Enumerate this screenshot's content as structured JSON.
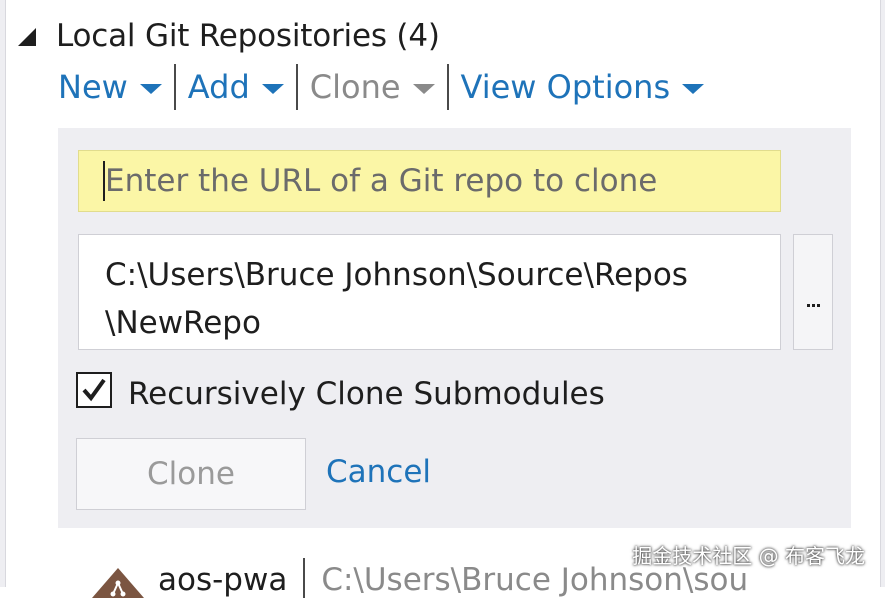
{
  "section": {
    "title": "Local Git Repositories (4)"
  },
  "toolbar": {
    "new_label": "New",
    "add_label": "Add",
    "clone_label": "Clone",
    "view_options_label": "View Options"
  },
  "clone_panel": {
    "url_placeholder": "Enter the URL of a Git repo to clone",
    "path_line1": "C:\\Users\\Bruce Johnson\\Source\\Repos",
    "path_line2": "\\NewRepo",
    "browse_label": "...",
    "recursive_label": "Recursively Clone Submodules",
    "recursive_checked": true,
    "clone_button_label": "Clone",
    "cancel_label": "Cancel"
  },
  "repo_list": [
    {
      "name": "aos-pwa",
      "path": "C:\\Users\\Bruce Johnson\\sou"
    }
  ],
  "watermark": "掘金技术社区 @ 布客飞龙",
  "colors": {
    "link": "#1e73b9",
    "input_highlight": "#fbf6a6",
    "panel_bg": "#eeeef2",
    "repo_icon": "#7b5541"
  }
}
